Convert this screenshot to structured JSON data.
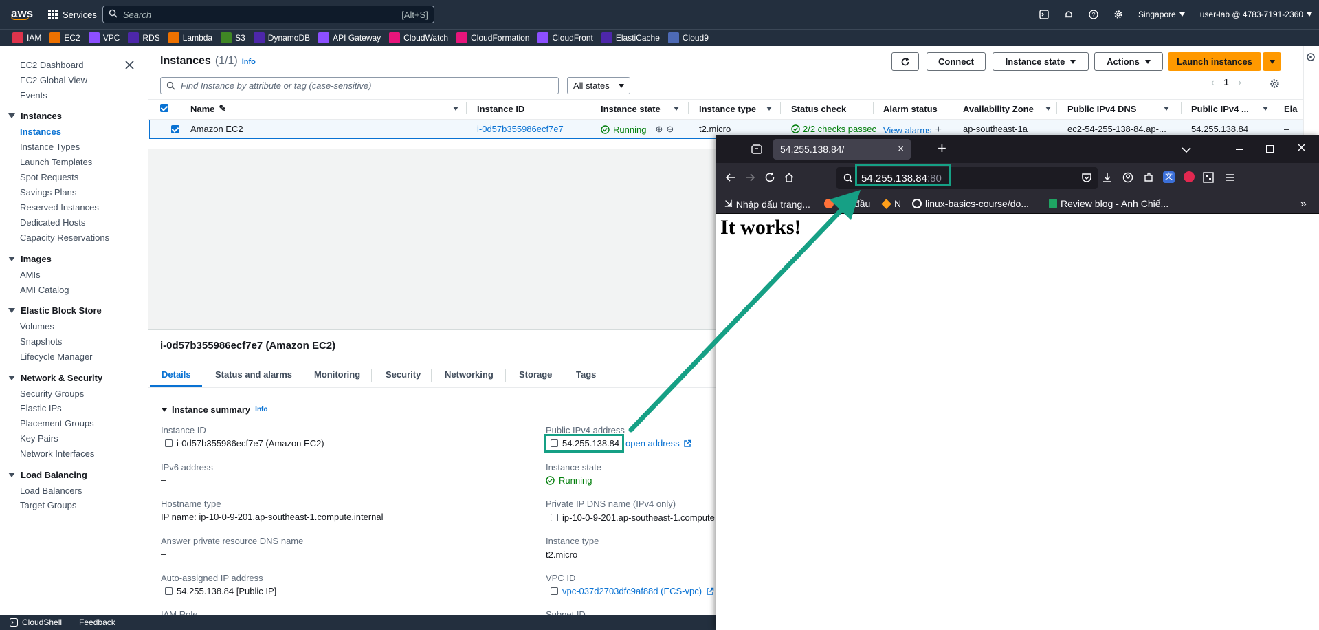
{
  "topnav": {
    "logo": "aws",
    "services_label": "Services",
    "search_placeholder": "Search",
    "search_shortcut": "[Alt+S]",
    "region": "Singapore",
    "account": "user-lab @ 4783-7191-2360"
  },
  "favorites": [
    {
      "label": "IAM",
      "color": "#dd344c"
    },
    {
      "label": "EC2",
      "color": "#ed7100"
    },
    {
      "label": "VPC",
      "color": "#8c4fff"
    },
    {
      "label": "RDS",
      "color": "#4d27aa"
    },
    {
      "label": "Lambda",
      "color": "#ed7100"
    },
    {
      "label": "S3",
      "color": "#3f8624"
    },
    {
      "label": "DynamoDB",
      "color": "#4d27aa"
    },
    {
      "label": "API Gateway",
      "color": "#8c4fff"
    },
    {
      "label": "CloudWatch",
      "color": "#e7157b"
    },
    {
      "label": "CloudFormation",
      "color": "#e7157b"
    },
    {
      "label": "CloudFront",
      "color": "#8c4fff"
    },
    {
      "label": "ElastiCache",
      "color": "#4d27aa"
    },
    {
      "label": "Cloud9",
      "color": "#4d6ab5"
    }
  ],
  "sidebar": {
    "top_items": [
      "EC2 Dashboard",
      "EC2 Global View",
      "Events"
    ],
    "sections": [
      {
        "title": "Instances",
        "items": [
          "Instances",
          "Instance Types",
          "Launch Templates",
          "Spot Requests",
          "Savings Plans",
          "Reserved Instances",
          "Dedicated Hosts",
          "Capacity Reservations"
        ]
      },
      {
        "title": "Images",
        "items": [
          "AMIs",
          "AMI Catalog"
        ]
      },
      {
        "title": "Elastic Block Store",
        "items": [
          "Volumes",
          "Snapshots",
          "Lifecycle Manager"
        ]
      },
      {
        "title": "Network & Security",
        "items": [
          "Security Groups",
          "Elastic IPs",
          "Placement Groups",
          "Key Pairs",
          "Network Interfaces"
        ]
      },
      {
        "title": "Load Balancing",
        "items": [
          "Load Balancers",
          "Target Groups"
        ]
      }
    ]
  },
  "instances": {
    "title": "Instances",
    "count": "(1/1)",
    "info": "Info",
    "connect": "Connect",
    "instance_state_btn": "Instance state",
    "actions_btn": "Actions",
    "launch_btn": "Launch instances",
    "find_placeholder": "Find Instance by attribute or tag (case-sensitive)",
    "state_filter": "All states",
    "page": "1",
    "columns": [
      "Name",
      "Instance ID",
      "Instance state",
      "Instance type",
      "Status check",
      "Alarm status",
      "Availability Zone",
      "Public IPv4 DNS",
      "Public IPv4 ...",
      "Ela"
    ],
    "row": {
      "name": "Amazon EC2",
      "id": "i-0d57b355986ecf7e7",
      "state": "Running",
      "type": "t2.micro",
      "status": "2/2 checks passec",
      "alarm": "View alarms",
      "az": "ap-southeast-1a",
      "dns": "ec2-54-255-138-84.ap-...",
      "ip": "54.255.138.84",
      "ela": "–"
    }
  },
  "details": {
    "title": "i-0d57b355986ecf7e7 (Amazon EC2)",
    "tabs": [
      "Details",
      "Status and alarms",
      "Monitoring",
      "Security",
      "Networking",
      "Storage",
      "Tags"
    ],
    "summary_title": "Instance summary",
    "info": "Info",
    "instance_id_label": "Instance ID",
    "instance_id": "i-0d57b355986ecf7e7 (Amazon EC2)",
    "ipv6_label": "IPv6 address",
    "ipv6": "–",
    "hostname_label": "Hostname type",
    "hostname": "IP name: ip-10-0-9-201.ap-southeast-1.compute.internal",
    "answer_dns_label": "Answer private resource DNS name",
    "answer_dns": "–",
    "auto_ip_label": "Auto-assigned IP address",
    "auto_ip": "54.255.138.84 [Public IP]",
    "iam_label": "IAM Role",
    "public_ip_label": "Public IPv4 address",
    "public_ip": "54.255.138.84",
    "open_address": "open address",
    "state_label": "Instance state",
    "state": "Running",
    "private_dns_label": "Private IP DNS name (IPv4 only)",
    "private_dns": "ip-10-0-9-201.ap-southeast-1.compute",
    "type_label": "Instance type",
    "type": "t2.micro",
    "vpc_label": "VPC ID",
    "vpc": "vpc-037d2703dfc9af88d (ECS-vpc)",
    "subnet_label": "Subnet ID"
  },
  "bottom": {
    "cloudshell": "CloudShell",
    "feedback": "Feedback"
  },
  "browser": {
    "tab_title": "54.255.138.84/",
    "url_host": "54.255.138.84",
    "url_port": ":80",
    "bookmarks": [
      "Nhập dấu trang...",
      "Bắt đầu",
      "N",
      "linux-basics-course/do...",
      "Review blog - Anh Chiế..."
    ],
    "page_heading": "It works!"
  },
  "colors": {
    "aws_nav": "#232f3e",
    "aws_orange": "#ff9900",
    "link": "#0972d3",
    "running": "#037f0c",
    "highlight": "#16a085",
    "firefox_dark": "#1c1b22"
  }
}
